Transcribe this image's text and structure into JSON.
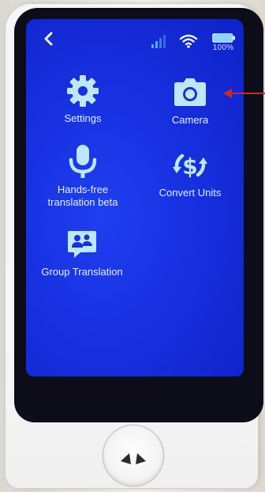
{
  "status_bar": {
    "battery_text": "100%",
    "signal_icon": "signal-icon",
    "wifi_icon": "wifi-icon",
    "battery_icon": "battery-icon"
  },
  "navigation": {
    "back_icon": "chevron-left-icon"
  },
  "menu": {
    "settings": {
      "label": "Settings",
      "icon": "gear-icon"
    },
    "camera": {
      "label": "Camera",
      "icon": "camera-icon"
    },
    "hands_free": {
      "label_line1": "Hands-free",
      "label_line2": "translation beta",
      "icon": "microphone-icon"
    },
    "convert_units": {
      "label": "Convert Units",
      "icon": "currency-exchange-icon"
    },
    "group_translation": {
      "label": "Group Translation",
      "icon": "group-chat-icon"
    }
  },
  "colors": {
    "screen_blue": "#1730e0",
    "icon_light_blue": "#bfe6ff",
    "annotation_red": "#d0281e"
  }
}
